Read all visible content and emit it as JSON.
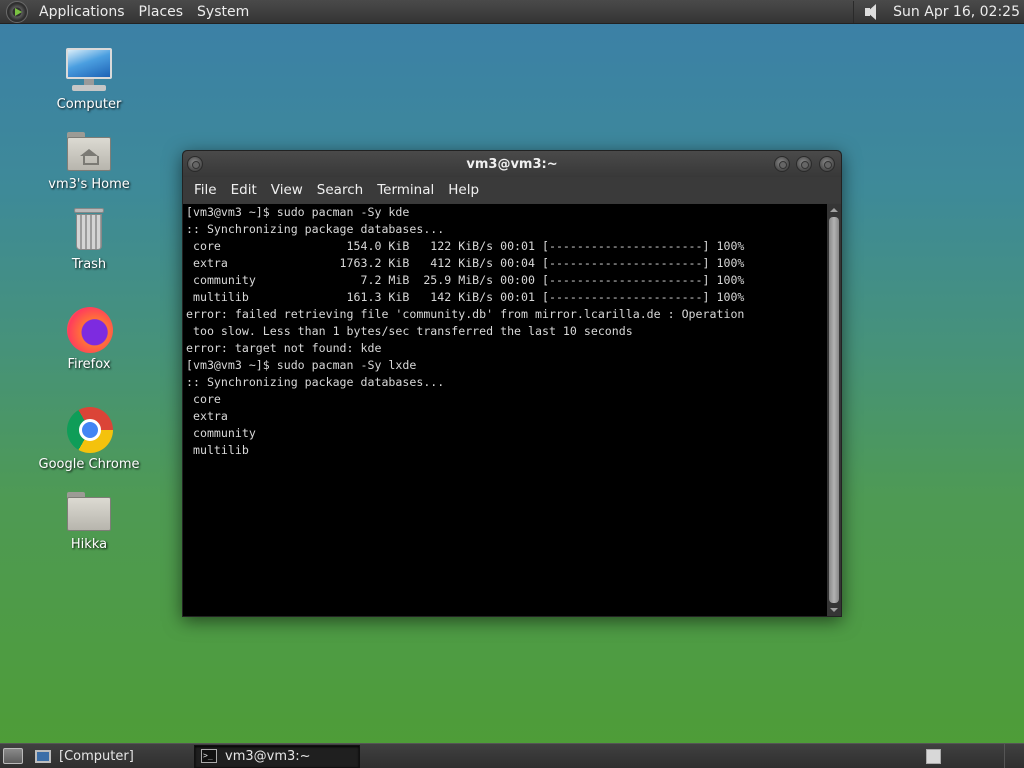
{
  "top_panel": {
    "menus": [
      "Applications",
      "Places",
      "System"
    ],
    "clock": "Sun Apr 16, 02:25"
  },
  "desktop_icons": [
    {
      "label": "Computer",
      "icon": "computer-icon"
    },
    {
      "label": "vm3's Home",
      "icon": "home-folder-icon"
    },
    {
      "label": "Trash",
      "icon": "trash-icon"
    },
    {
      "label": "Firefox",
      "icon": "firefox-icon"
    },
    {
      "label": "Google Chrome",
      "icon": "chrome-icon"
    },
    {
      "label": "Hikka",
      "icon": "folder-icon"
    }
  ],
  "terminal": {
    "title": "vm3@vm3:~",
    "menu": [
      "File",
      "Edit",
      "View",
      "Search",
      "Terminal",
      "Help"
    ],
    "lines": [
      "[vm3@vm3 ~]$ sudo pacman -Sy kde",
      ":: Synchronizing package databases...",
      " core                  154.0 KiB   122 KiB/s 00:01 [----------------------] 100%",
      " extra                1763.2 KiB   412 KiB/s 00:04 [----------------------] 100%",
      " community               7.2 MiB  25.9 MiB/s 00:00 [----------------------] 100%",
      " multilib              161.3 KiB   142 KiB/s 00:01 [----------------------] 100%",
      "error: failed retrieving file 'community.db' from mirror.lcarilla.de : Operation",
      " too slow. Less than 1 bytes/sec transferred the last 10 seconds",
      "error: target not found: kde",
      "[vm3@vm3 ~]$ sudo pacman -Sy lxde",
      ":: Synchronizing package databases...",
      " core",
      " extra",
      " community",
      " multilib"
    ]
  },
  "taskbar": {
    "tasks": [
      {
        "label": "[Computer]",
        "active": false
      },
      {
        "label": "vm3@vm3:~",
        "active": true
      }
    ]
  }
}
